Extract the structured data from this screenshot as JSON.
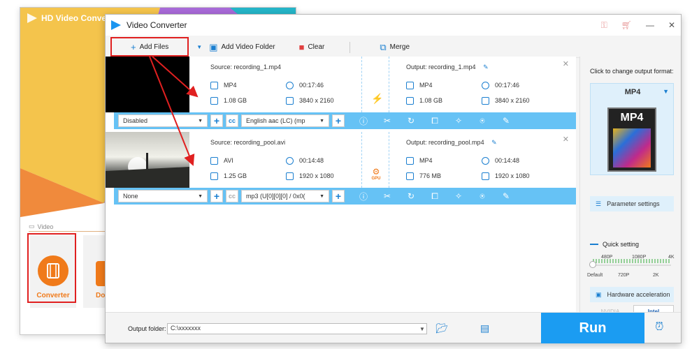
{
  "launcher": {
    "title": "HD Video Converter",
    "section_label": "Video",
    "tiles": [
      {
        "label": "Converter"
      },
      {
        "label": "Downl"
      }
    ]
  },
  "window": {
    "title": "Video Converter"
  },
  "toolbar": {
    "add_files": "Add Files",
    "add_folder": "Add Video Folder",
    "clear": "Clear",
    "merge": "Merge"
  },
  "files": [
    {
      "source": "Source: recording_1.mp4",
      "src_format": "MP4",
      "src_duration": "00:17:46",
      "src_size": "1.08 GB",
      "src_resolution": "3840 x 2160",
      "output": "Output: recording_1.mp4",
      "out_format": "MP4",
      "out_duration": "00:17:46",
      "out_size": "1.08 GB",
      "out_resolution": "3840 x 2160",
      "subtitle": "Disabled",
      "audio": "English aac (LC) (mp"
    },
    {
      "source": "Source: recording_pool.avi",
      "src_format": "AVI",
      "src_duration": "00:14:48",
      "src_size": "1.25 GB",
      "src_resolution": "1920 x 1080",
      "output": "Output: recording_pool.mp4",
      "out_format": "MP4",
      "out_duration": "00:14:48",
      "out_size": "776 MB",
      "out_resolution": "1920 x 1080",
      "subtitle": "None",
      "audio": "mp3 (U[0][0][0] / 0x0(",
      "gpu_label": "GPU"
    }
  ],
  "right_panel": {
    "change_format": "Click to change output format:",
    "format_name": "MP4",
    "format_icon_text": "MP4",
    "parameter_settings": "Parameter settings",
    "quick_setting": "Quick setting",
    "ticks_top": [
      "480P",
      "1080P",
      "4K"
    ],
    "ticks_bottom": [
      "Default",
      "720P",
      "2K"
    ],
    "hardware_acceleration": "Hardware acceleration",
    "nvidia": "NVIDIA",
    "intel": "Intel"
  },
  "bottom": {
    "output_folder_label": "Output folder:",
    "output_folder_value": "C:\\xxxxxxx",
    "run": "Run"
  }
}
